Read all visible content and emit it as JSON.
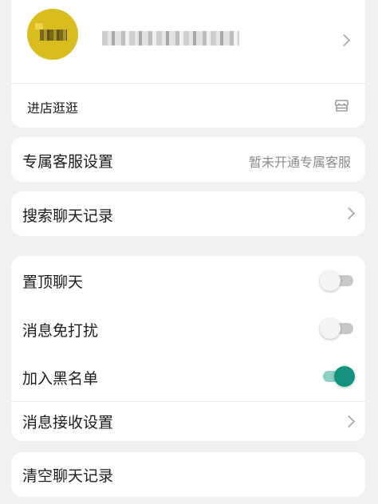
{
  "shop": {
    "name": "",
    "visit_label": "进店逛逛",
    "store_icon": "store-icon",
    "chevron_icon": "chevron-right-icon"
  },
  "service": {
    "label": "专属客服设置",
    "value": "暂未开通专属客服"
  },
  "search": {
    "label": "搜索聊天记录"
  },
  "settings": {
    "pin_label": "置顶聊天",
    "pin_on": false,
    "mute_label": "消息免打扰",
    "mute_on": false,
    "blacklist_label": "加入黑名单",
    "blacklist_on": true,
    "receive_label": "消息接收设置"
  },
  "clear": {
    "label": "清空聊天记录"
  },
  "colors": {
    "background": "#f1f1f1",
    "card": "#ffffff",
    "accent": "#16917f",
    "avatar": "#d9bd1f"
  }
}
